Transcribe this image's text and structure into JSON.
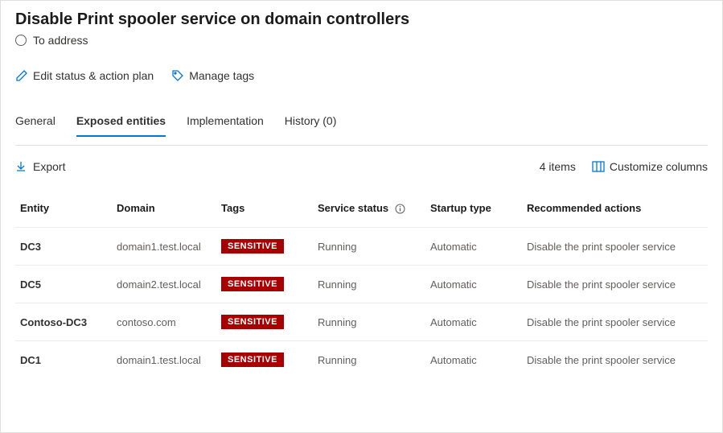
{
  "header": {
    "title": "Disable Print spooler service on domain controllers",
    "status_label": "To address"
  },
  "actions": {
    "edit_label": "Edit status & action plan",
    "manage_tags_label": "Manage tags"
  },
  "tabs": {
    "general": "General",
    "exposed_entities": "Exposed entities",
    "implementation": "Implementation",
    "history": "History (0)"
  },
  "toolbar": {
    "export_label": "Export",
    "items_count": "4 items",
    "customize_label": "Customize columns"
  },
  "table": {
    "headers": {
      "entity": "Entity",
      "domain": "Domain",
      "tags": "Tags",
      "service_status": "Service status",
      "startup_type": "Startup type",
      "recommended_actions": "Recommended actions"
    },
    "rows": [
      {
        "entity": "DC3",
        "domain": "domain1.test.local",
        "tag": "SENSITIVE",
        "service_status": "Running",
        "startup_type": "Automatic",
        "recommended": "Disable the print spooler service"
      },
      {
        "entity": "DC5",
        "domain": "domain2.test.local",
        "tag": "SENSITIVE",
        "service_status": "Running",
        "startup_type": "Automatic",
        "recommended": "Disable the print spooler service"
      },
      {
        "entity": "Contoso-DC3",
        "domain": "contoso.com",
        "tag": "SENSITIVE",
        "service_status": "Running",
        "startup_type": "Automatic",
        "recommended": "Disable the print spooler service"
      },
      {
        "entity": "DC1",
        "domain": "domain1.test.local",
        "tag": "SENSITIVE",
        "service_status": "Running",
        "startup_type": "Automatic",
        "recommended": "Disable the print spooler service"
      }
    ]
  }
}
